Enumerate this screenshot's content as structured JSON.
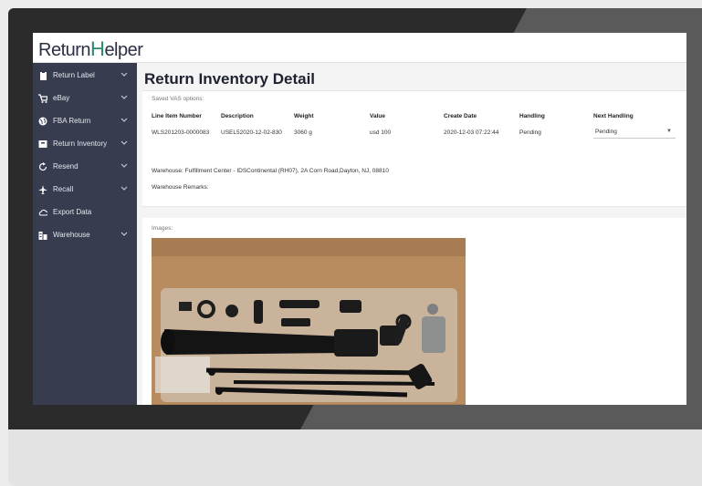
{
  "app": {
    "logo_prefix": "R",
    "logo_mid": "eturn",
    "logo_accent": "H",
    "logo_suffix": "elper"
  },
  "sidebar": {
    "items": [
      {
        "label": "Return Label",
        "icon": "clipboard-icon"
      },
      {
        "label": "eBay",
        "icon": "cart-icon"
      },
      {
        "label": "FBA Return",
        "icon": "globe-icon"
      },
      {
        "label": "Return Inventory",
        "icon": "box-icon"
      },
      {
        "label": "Resend",
        "icon": "refresh-icon"
      },
      {
        "label": "Recall",
        "icon": "plane-icon"
      },
      {
        "label": "Export Data",
        "icon": "cloud-icon"
      },
      {
        "label": "Warehouse",
        "icon": "building-icon"
      }
    ]
  },
  "page": {
    "title": "Return Inventory Detail",
    "vas_label": "Saved VAS options:",
    "table": {
      "headers": [
        "Line Item Number",
        "Description",
        "Weight",
        "Value",
        "Create Date",
        "Handling",
        "Next Handling"
      ],
      "row": [
        "WLS201203-0000083",
        "USEL52020-12-02-830",
        "3060 g",
        "usd 100",
        "2020-12-03 07:22:44",
        "Pending"
      ]
    },
    "next_handling": "Pending",
    "warehouse_line": "Warehouse: Fulfillment Center - IDSContinental (RH07), 2A Corn Road,Dayton, NJ, 08810",
    "remarks_label": "Warehouse Remarks:",
    "images_label": "Images:"
  },
  "colors": {
    "sidebar_bg": "#373d4f",
    "accent": "#2a8a6a",
    "frame": "#2b2b2b"
  }
}
